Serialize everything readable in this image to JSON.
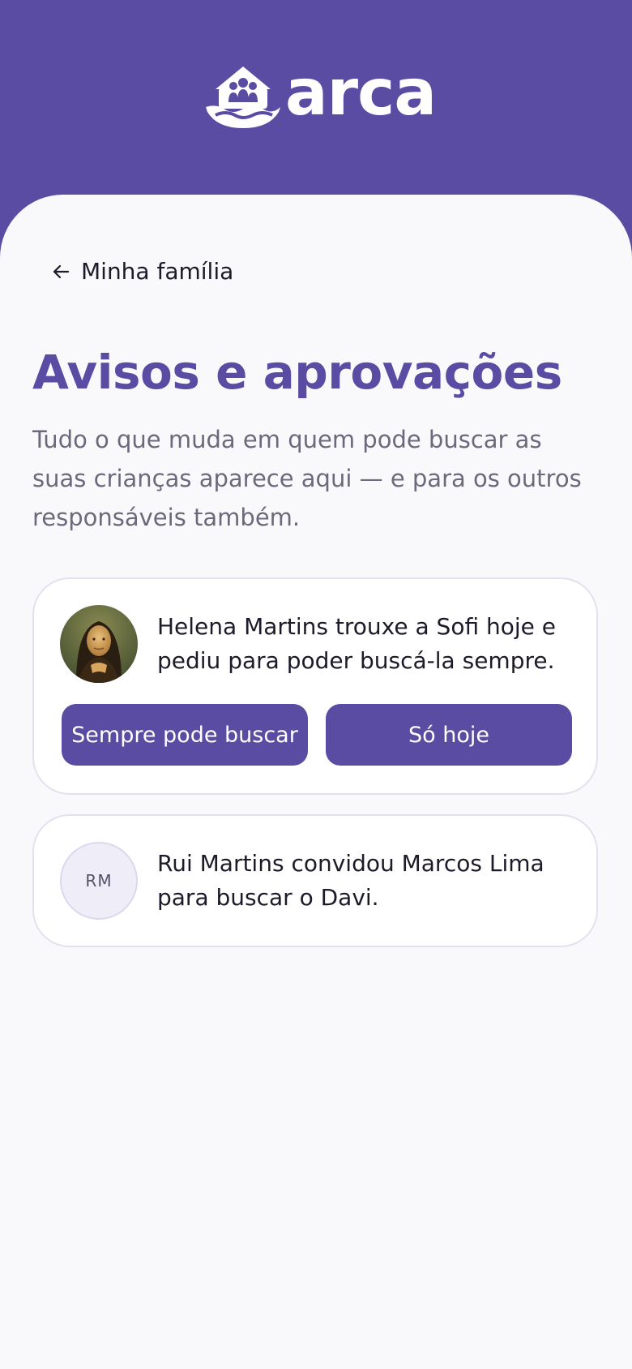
{
  "header": {
    "logo_text": "arca",
    "brand_color": "#5a4ca2"
  },
  "nav": {
    "back_label": "Minha família",
    "back_icon": "arrow-left-icon"
  },
  "page": {
    "title": "Avisos e aprovações",
    "subtitle": "Tudo o que muda em quem pode buscar as suas crianças aparece aqui — e para os outros responsáveis também."
  },
  "notices": [
    {
      "avatar": "photo",
      "message": "Helena Martins trouxe a Sofi hoje e pediu para poder buscá-la sempre.",
      "actions": {
        "always_label": "Sempre pode buscar",
        "today_label": "Só hoje"
      }
    },
    {
      "avatar_initials": "RM",
      "message": "Rui Martins convidou Marcos Lima para buscar o Davi."
    }
  ]
}
